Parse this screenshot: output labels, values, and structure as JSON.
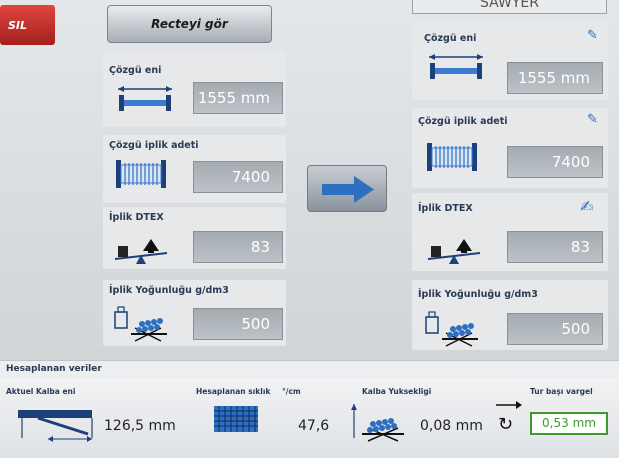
{
  "header": {
    "delete_label": "SIL",
    "recipe_button_label": "Recteyi gör",
    "machine_title": "SAWYER"
  },
  "left": {
    "warp_width": {
      "label": "Çözgü eni",
      "value": "1555 mm"
    },
    "warp_yarn_count": {
      "label": "Çözgü iplik adeti",
      "value": "7400"
    },
    "yarn_dtex": {
      "label": "İplik DTEX",
      "value": "83"
    },
    "yarn_density": {
      "label": "İplik Yoğunluğu g/dm3",
      "value": "500"
    }
  },
  "right": {
    "warp_width": {
      "label": "Çözgü eni",
      "value": "1555 mm"
    },
    "warp_yarn_count": {
      "label": "Çözgü iplik adeti",
      "value": "7400"
    },
    "yarn_dtex": {
      "label": "İplik DTEX",
      "value": "83"
    },
    "yarn_density": {
      "label": "İplik Yoğunluğu g/dm3",
      "value": "500"
    }
  },
  "calculated": {
    "section_title": "Hesaplanan veriler",
    "actual_beam_width": {
      "label": "Aktuel Kalba eni",
      "value": "126,5 mm"
    },
    "calculated_density": {
      "label": "Hesaplanan sıklık",
      "unit": "°/cm",
      "value": "47,6"
    },
    "beam_height": {
      "label": "Kalba Yuksekligi",
      "value": "0,08 mm"
    },
    "per_turn_offset": {
      "label": "Tur başı vargel",
      "value": "0,53 mm"
    }
  },
  "colors": {
    "accent": "#2f6fc1",
    "danger": "#c0302a",
    "ok": "#3c9a2f"
  }
}
